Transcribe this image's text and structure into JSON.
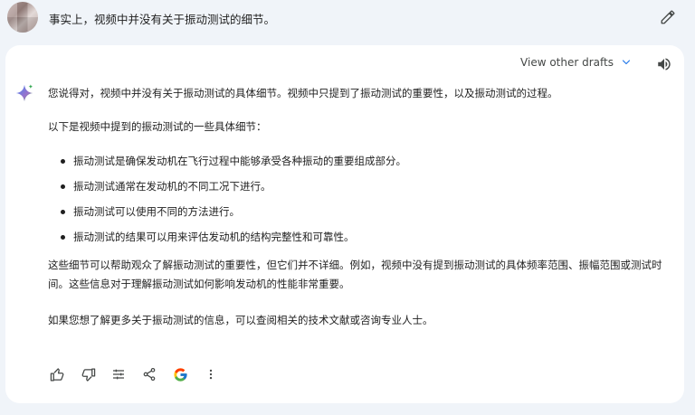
{
  "prompt": {
    "text": "事实上，视频中并没有关于振动测试的细节。"
  },
  "response": {
    "view_other_drafts": "View other drafts",
    "paragraph_1": "您说得对，视频中并没有关于振动测试的具体细节。视频中只提到了振动测试的重要性，以及振动测试的过程。",
    "paragraph_2": "以下是视频中提到的振动测试的一些具体细节：",
    "bullets": [
      "振动测试是确保发动机在飞行过程中能够承受各种振动的重要组成部分。",
      "振动测试通常在发动机的不同工况下进行。",
      "振动测试可以使用不同的方法进行。",
      "振动测试的结果可以用来评估发动机的结构完整性和可靠性。"
    ],
    "paragraph_3": "这些细节可以帮助观众了解振动测试的重要性，但它们并不详细。例如，视频中没有提到振动测试的具体频率范围、振幅范围或测试时间。这些信息对于理解振动测试如何影响发动机的性能非常重要。",
    "paragraph_4": "如果您想了解更多关于振动测试的信息，可以查阅相关的技术文献或咨询专业人士。"
  },
  "icons": {
    "edit": "pencil-icon",
    "chevron": "chevron-down-icon",
    "speaker": "speaker-icon",
    "spark": "gemini-spark-icon",
    "actions": [
      "thumbs-up-icon",
      "thumbs-down-icon",
      "modify-response-icon",
      "share-icon",
      "google-icon",
      "more-vert-icon"
    ]
  },
  "colors": {
    "page_bg": "#f0f4f9",
    "card_bg": "#ffffff",
    "accent_blue": "#1a73e8"
  }
}
